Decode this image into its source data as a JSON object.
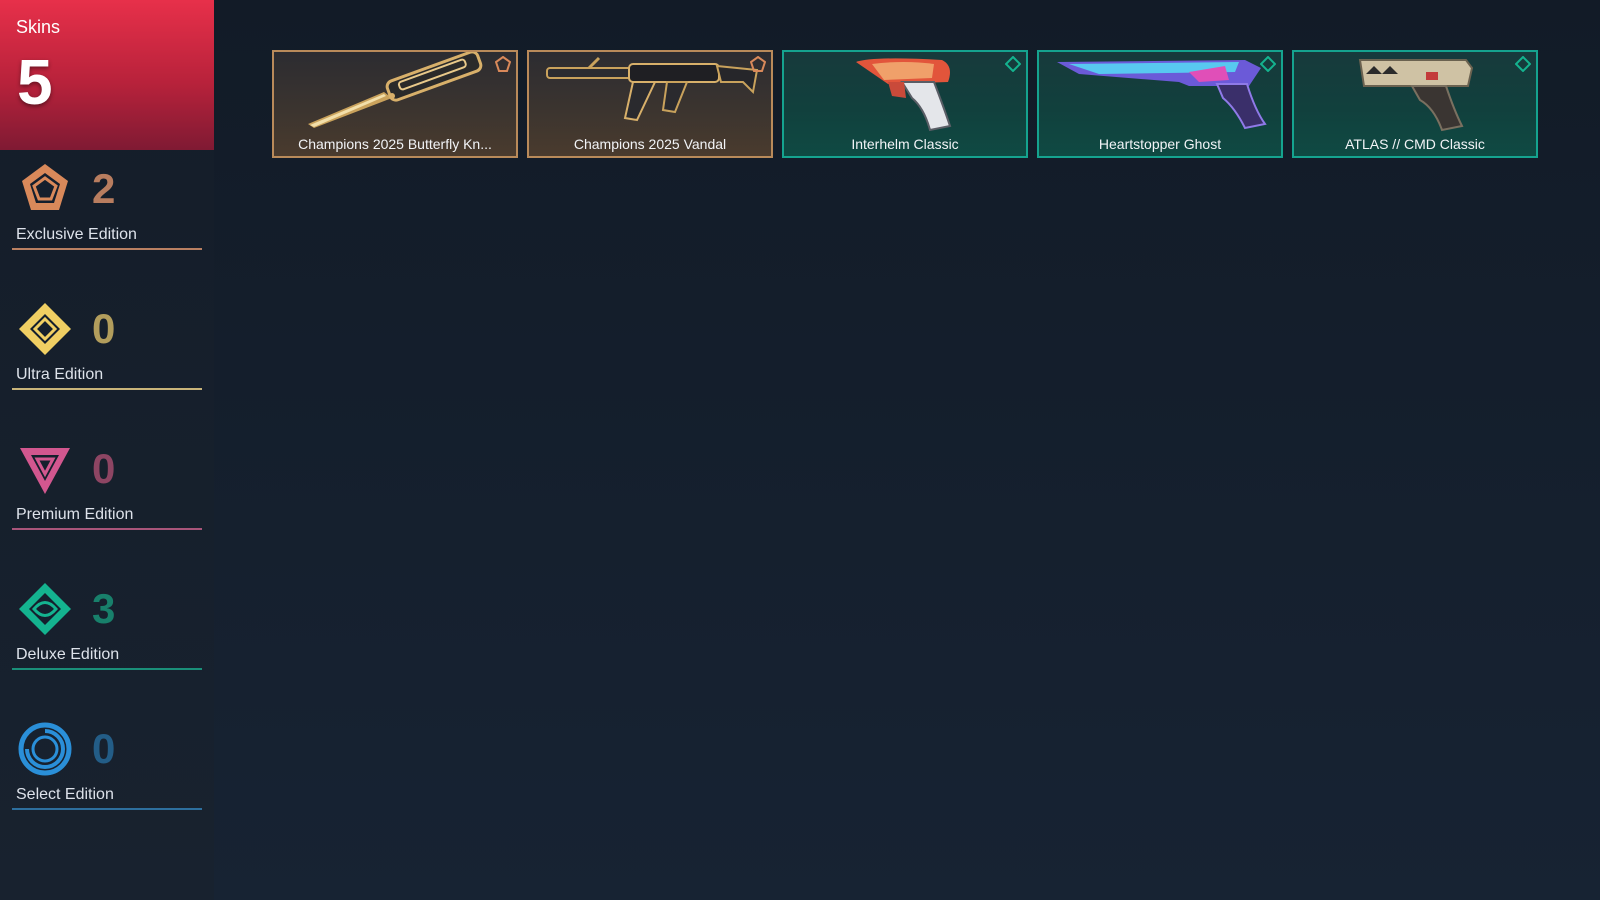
{
  "summary": {
    "label": "Skins",
    "count": "5"
  },
  "tiers": [
    {
      "key": "exclusive",
      "label": "Exclusive Edition",
      "count": "2",
      "color": "#d9895a",
      "count_color": "#b87d5f",
      "icon": "exclusive-edition-icon"
    },
    {
      "key": "ultra",
      "label": "Ultra Edition",
      "count": "0",
      "color": "#f0cf63",
      "count_color": "#b29d5c",
      "icon": "ultra-edition-icon"
    },
    {
      "key": "premium",
      "label": "Premium Edition",
      "count": "0",
      "color": "#d2578f",
      "count_color": "#8d4563",
      "icon": "premium-edition-icon"
    },
    {
      "key": "deluxe",
      "label": "Deluxe Edition",
      "count": "3",
      "color": "#14b38f",
      "count_color": "#18806b",
      "icon": "deluxe-edition-icon"
    },
    {
      "key": "select",
      "label": "Select Edition",
      "count": "0",
      "color": "#2a8fd8",
      "count_color": "#235d87",
      "icon": "select-edition-icon"
    }
  ],
  "skins": [
    {
      "name": "Champions 2025 Butterfly Kn...",
      "tier": "exclusive",
      "art": "butterfly-knife-art"
    },
    {
      "name": "Champions 2025 Vandal",
      "tier": "exclusive",
      "art": "vandal-rifle-art"
    },
    {
      "name": "Interhelm Classic",
      "tier": "deluxe",
      "art": "classic-pistol-art"
    },
    {
      "name": "Heartstopper Ghost",
      "tier": "deluxe",
      "art": "ghost-pistol-art"
    },
    {
      "name": "ATLAS // CMD Classic",
      "tier": "deluxe",
      "art": "atlas-classic-pistol-art"
    }
  ]
}
